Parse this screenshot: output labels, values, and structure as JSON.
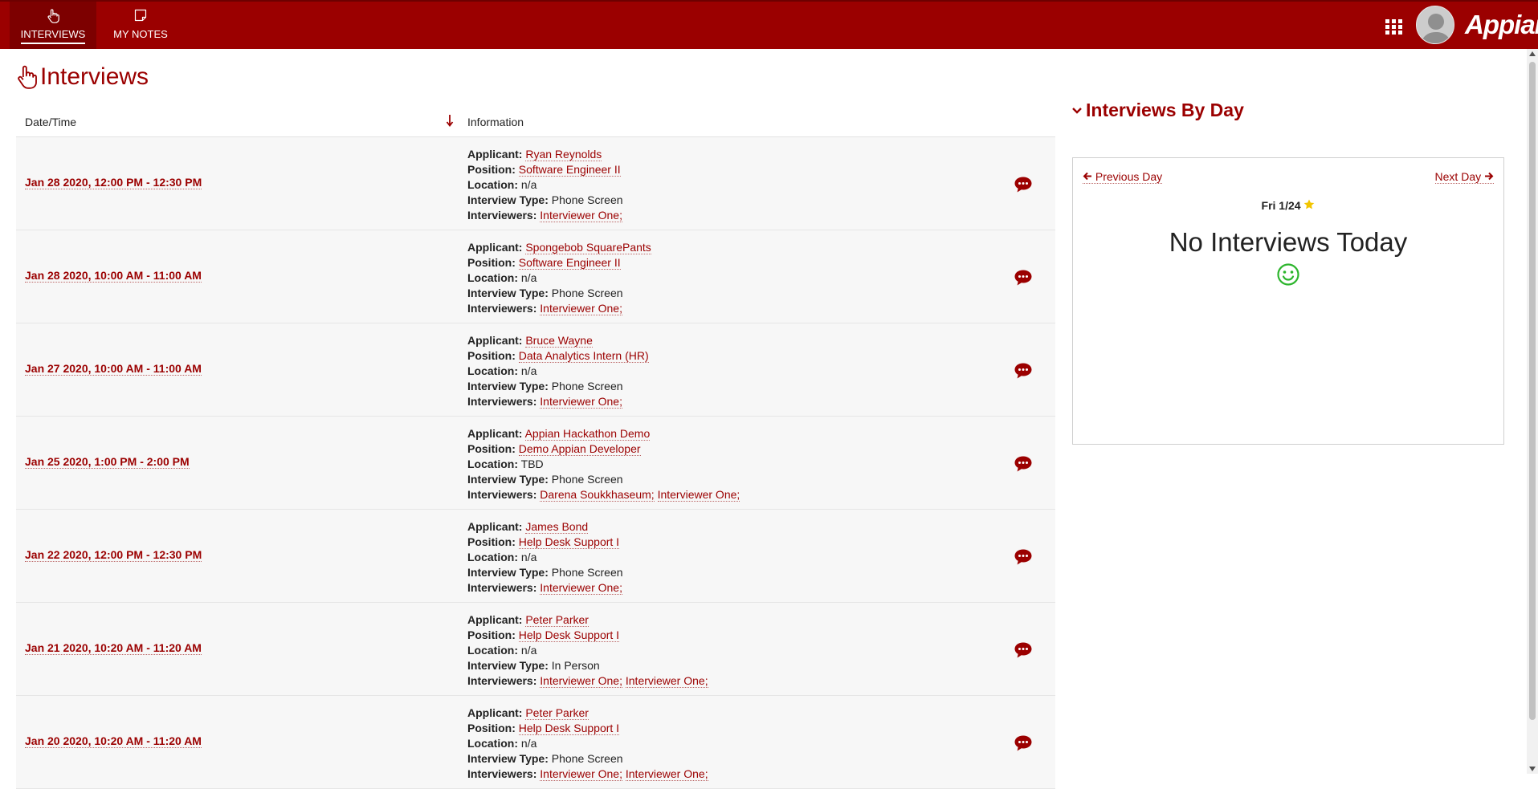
{
  "header": {
    "tabs": [
      {
        "label": "INTERVIEWS",
        "icon": "pointer-hand-icon",
        "active": true
      },
      {
        "label": "MY NOTES",
        "icon": "note-icon",
        "active": false
      }
    ],
    "brand": "Appian",
    "accent_color": "#9b0000"
  },
  "main": {
    "title": "Interviews",
    "columns": [
      "Date/Time",
      "Information"
    ],
    "sort_column": "Date/Time",
    "sort_direction": "descending",
    "field_labels": {
      "applicant": "Applicant:",
      "position": "Position:",
      "location": "Location:",
      "interview_type": "Interview Type:",
      "interviewers": "Interviewers:"
    },
    "rows": [
      {
        "datetime": "Jan 28 2020, 12:00 PM - 12:30 PM",
        "applicant": "Ryan Reynolds",
        "position": "Software Engineer II",
        "location": "n/a",
        "interview_type": "Phone Screen",
        "interviewers": [
          "Interviewer One;"
        ]
      },
      {
        "datetime": "Jan 28 2020, 10:00 AM - 11:00 AM",
        "applicant": "Spongebob SquarePants",
        "position": "Software Engineer II",
        "location": "n/a",
        "interview_type": "Phone Screen",
        "interviewers": [
          "Interviewer One;"
        ]
      },
      {
        "datetime": "Jan 27 2020, 10:00 AM - 11:00 AM",
        "applicant": "Bruce Wayne",
        "position": "Data Analytics Intern (HR)",
        "location": "n/a",
        "interview_type": "Phone Screen",
        "interviewers": [
          "Interviewer One;"
        ]
      },
      {
        "datetime": "Jan 25 2020, 1:00 PM - 2:00 PM",
        "applicant": "Appian Hackathon Demo",
        "position": "Demo Appian Developer",
        "location": "TBD",
        "interview_type": "Phone Screen",
        "interviewers": [
          "Darena Soukkhaseum;",
          "Interviewer One;"
        ]
      },
      {
        "datetime": "Jan 22 2020, 12:00 PM - 12:30 PM",
        "applicant": "James Bond",
        "position": "Help Desk Support I",
        "location": "n/a",
        "interview_type": "Phone Screen",
        "interviewers": [
          "Interviewer One;"
        ]
      },
      {
        "datetime": "Jan 21 2020, 10:20 AM - 11:20 AM",
        "applicant": "Peter Parker",
        "position": "Help Desk Support I",
        "location": "n/a",
        "interview_type": "In Person",
        "interviewers": [
          "Interviewer One;",
          "Interviewer One;"
        ]
      },
      {
        "datetime": "Jan 20 2020, 10:20 AM - 11:20 AM",
        "applicant": "Peter Parker",
        "position": "Help Desk Support I",
        "location": "n/a",
        "interview_type": "Phone Screen",
        "interviewers": [
          "Interviewer One;",
          "Interviewer One;"
        ]
      }
    ]
  },
  "sidebar": {
    "title": "Interviews By Day",
    "prev_label": "Previous Day",
    "next_label": "Next Day",
    "day": "Fri 1/24",
    "message": "No Interviews Today",
    "star_color": "#f2c500",
    "smile_color": "#2db52d"
  }
}
